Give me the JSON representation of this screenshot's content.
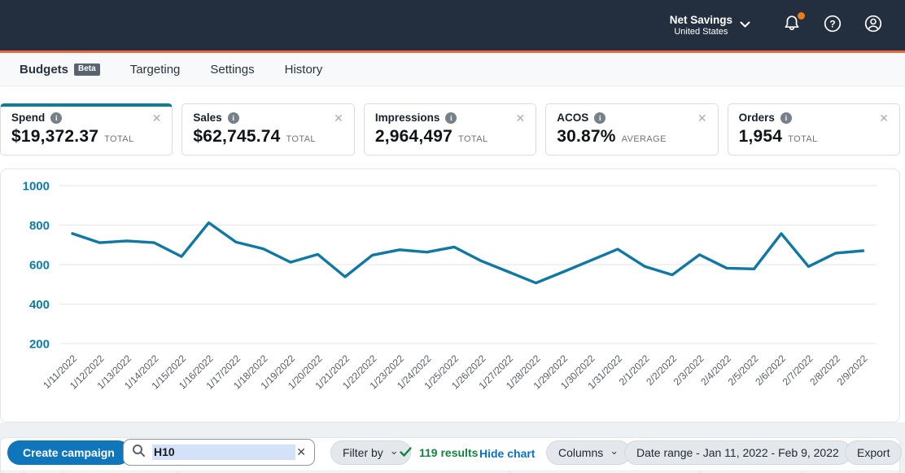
{
  "navbar": {
    "account_name": "Net Savings",
    "account_region": "United States",
    "icons": [
      "chevron-down-icon",
      "bell-icon",
      "help-icon",
      "account-icon"
    ],
    "notification_dot_color": "#ee7b17",
    "background_color": "#232f3e",
    "accent_bar_color": "#ec663c"
  },
  "tabs": [
    {
      "label": "Budgets",
      "badge": "Beta",
      "active": true
    },
    {
      "label": "Targeting"
    },
    {
      "label": "Settings"
    },
    {
      "label": "History"
    }
  ],
  "metric_cards": [
    {
      "label": "Spend",
      "value": "$19,372.37",
      "unit": "TOTAL",
      "selected": true
    },
    {
      "label": "Sales",
      "value": "$62,745.74",
      "unit": "TOTAL"
    },
    {
      "label": "Impressions",
      "value": "2,964,497",
      "unit": "TOTAL"
    },
    {
      "label": "ACOS",
      "value": "30.87%",
      "unit": "AVERAGE"
    },
    {
      "label": "Orders",
      "value": "1,954",
      "unit": "TOTAL"
    }
  ],
  "chart_data": {
    "type": "line",
    "title": "",
    "x": [
      "1/11/2022",
      "1/12/2022",
      "1/13/2022",
      "1/14/2022",
      "1/15/2022",
      "1/16/2022",
      "1/17/2022",
      "1/18/2022",
      "1/19/2022",
      "1/20/2022",
      "1/21/2022",
      "1/22/2022",
      "1/23/2022",
      "1/24/2022",
      "1/25/2022",
      "1/26/2022",
      "1/27/2022",
      "1/28/2022",
      "1/29/2022",
      "1/30/2022",
      "1/31/2022",
      "2/1/2022",
      "2/2/2022",
      "2/3/2022",
      "2/4/2022",
      "2/5/2022",
      "2/6/2022",
      "2/7/2022",
      "2/8/2022",
      "2/9/2022"
    ],
    "series": [
      {
        "name": "Spend",
        "values": [
          757,
          711,
          720,
          711,
          641,
          812,
          714,
          680,
          612,
          652,
          538,
          648,
          675,
          663,
          689,
          618,
          563,
          507,
          563,
          620,
          678,
          590,
          548,
          650,
          582,
          578,
          757,
          590,
          658,
          670
        ]
      }
    ],
    "yticks": [
      1000,
      800,
      600,
      400,
      200
    ],
    "ylim": [
      100,
      1050
    ],
    "grid": true,
    "legend_position": "none",
    "line_color": "#1177a3",
    "tick_label_color": "#0e7aa8",
    "x_label_color": "#565d66"
  },
  "toolbar": {
    "create_button_label": "Create campaign",
    "search": {
      "value": "H10",
      "icon": "search-icon",
      "clear_icon": "close-icon"
    },
    "filter_label": "Filter by",
    "results_text": "119 results",
    "hide_chart_label": "Hide chart",
    "columns_label": "Columns",
    "date_range_label": "Date range - Jan 11, 2022 - Feb 9, 2022",
    "export_label": "Export"
  },
  "colors": {
    "accent_teal": "#0e7e96",
    "primary_button_blue": "#0f76bb",
    "link_blue": "#0c72bd",
    "results_green": "#148342"
  }
}
